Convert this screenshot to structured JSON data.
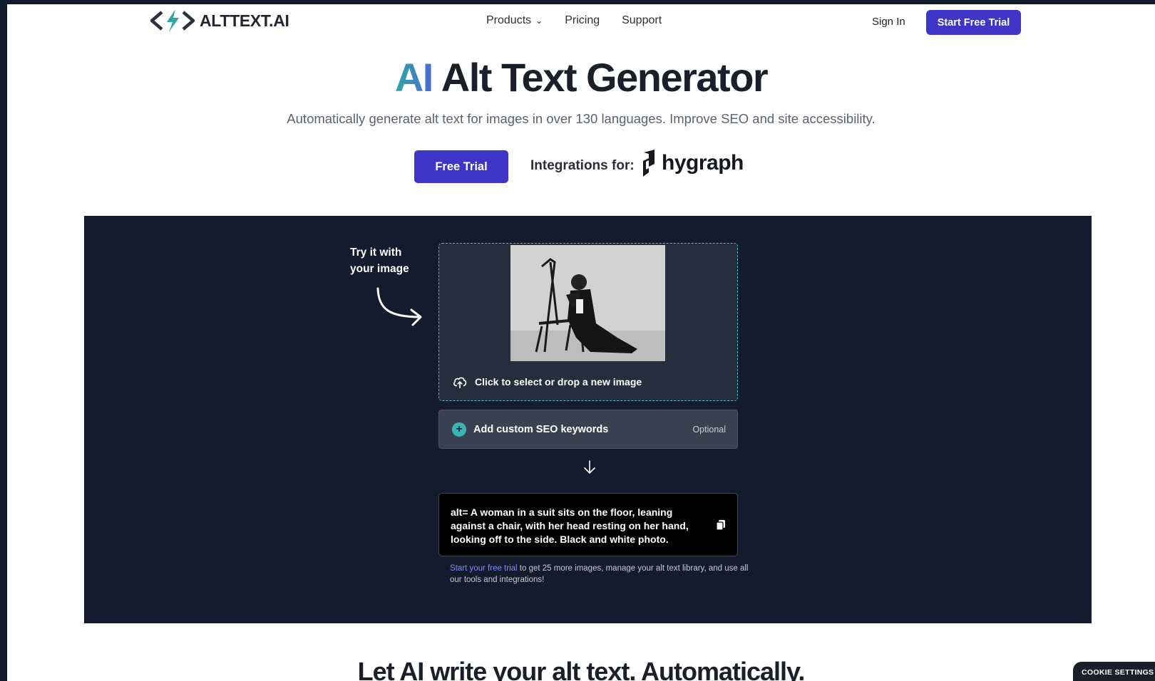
{
  "header": {
    "logo_text": "ALTTEXT.AI",
    "nav": {
      "products": "Products",
      "pricing": "Pricing",
      "support": "Support"
    },
    "sign_in": "Sign In",
    "start_trial": "Start Free Trial"
  },
  "hero": {
    "title_ai": "AI",
    "title_rest": " Alt Text Generator",
    "subtitle": "Automatically generate alt text for images in over 130 languages. Improve SEO and site accessibility.",
    "free_trial": "Free Trial",
    "integrations_label": "Integrations for:",
    "integration_brand": "hygraph"
  },
  "demo": {
    "try_line1": "Try it with",
    "try_line2": "your image",
    "drop_label": "Click to select or drop a new image",
    "seo_label": "Add custom SEO keywords",
    "seo_optional": "Optional",
    "alt_text": "alt= A woman in a suit sits on the floor, leaning against a chair, with her head resting on her hand, looking off to the side. Black and white photo.",
    "note_link": "Start your free trial",
    "note_rest": " to get 25 more images, manage your alt text library, and use all our tools and integrations!"
  },
  "section": {
    "title": "Let AI write your alt text. Automatically."
  },
  "cookie": {
    "label": "COOKIE SETTINGS"
  },
  "colors": {
    "accent": "#3f36c8",
    "dark_panel": "#141b2c",
    "teal": "#39b6b4"
  }
}
